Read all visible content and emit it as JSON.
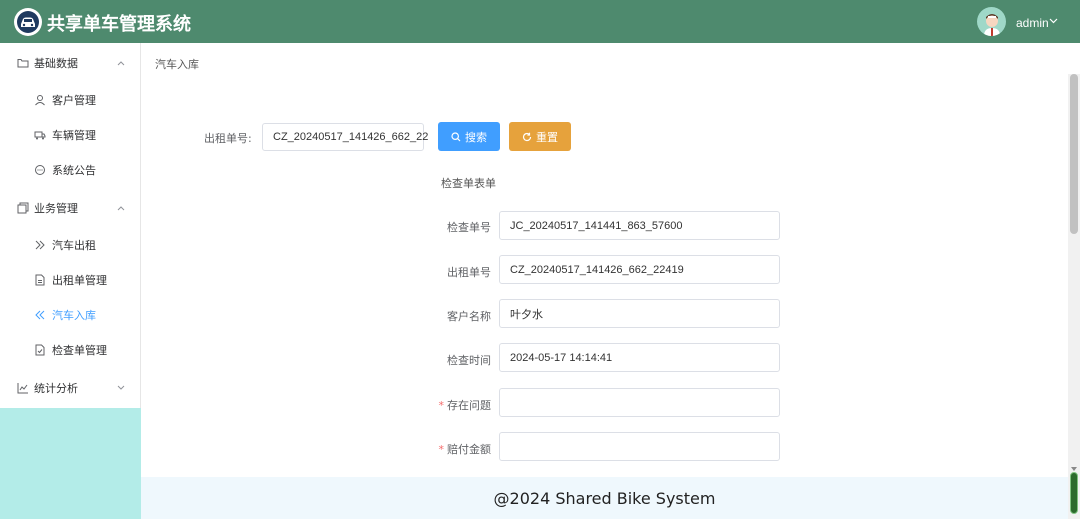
{
  "header": {
    "app_title": "共享单车管理系统",
    "user_name": "admin",
    "bg_color": "#4e8a6e"
  },
  "sidebar": {
    "items": [
      {
        "label": "基础数据",
        "icon": "folder-icon",
        "kind": "group",
        "expanded": true
      },
      {
        "label": "客户管理",
        "icon": "user-icon",
        "kind": "item"
      },
      {
        "label": "车辆管理",
        "icon": "truck-icon",
        "kind": "item"
      },
      {
        "label": "系统公告",
        "icon": "chat-icon",
        "kind": "item"
      },
      {
        "label": "业务管理",
        "icon": "copy-icon",
        "kind": "group",
        "expanded": true
      },
      {
        "label": "汽车出租",
        "icon": "double-right-icon",
        "kind": "item"
      },
      {
        "label": "出租单管理",
        "icon": "document-icon",
        "kind": "item"
      },
      {
        "label": "汽车入库",
        "icon": "double-left-icon",
        "kind": "item",
        "active": true
      },
      {
        "label": "检查单管理",
        "icon": "document-check-icon",
        "kind": "item"
      },
      {
        "label": "统计分析",
        "icon": "chart-icon",
        "kind": "group",
        "expanded": false
      }
    ]
  },
  "breadcrumb": "汽车入库",
  "search": {
    "label": "出租单号:",
    "value": "CZ_20240517_141426_662_22",
    "search_button": "搜索",
    "reset_button": "重置"
  },
  "form": {
    "title": "检查单表单",
    "fields": [
      {
        "label": "检查单号",
        "value": "JC_20240517_141441_863_57600",
        "required": false
      },
      {
        "label": "出租单号",
        "value": "CZ_20240517_141426_662_22419",
        "required": false
      },
      {
        "label": "客户名称",
        "value": "叶夕水",
        "required": false
      },
      {
        "label": "检查时间",
        "value": "2024-05-17 14:14:41",
        "required": false
      },
      {
        "label": "存在问题",
        "value": "",
        "required": true
      },
      {
        "label": "赔付金额",
        "value": "",
        "required": true
      }
    ]
  },
  "footer": "@2024 Shared Bike System",
  "colors": {
    "primary": "#409eff",
    "warning": "#e6a23c",
    "danger": "#f56c6c"
  }
}
